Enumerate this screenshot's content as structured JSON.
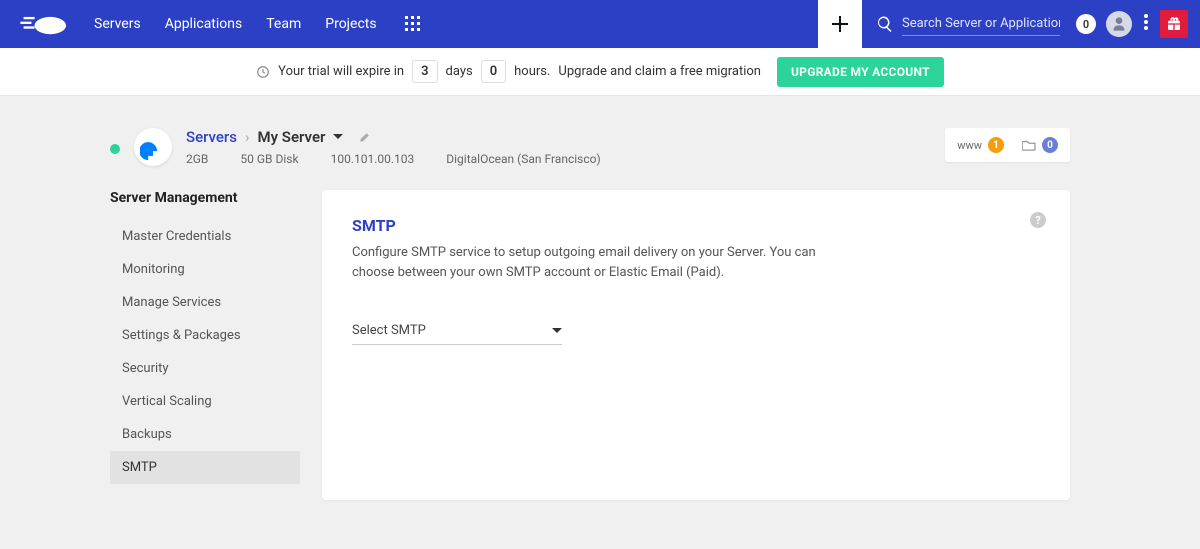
{
  "nav": {
    "servers": "Servers",
    "applications": "Applications",
    "team": "Team",
    "projects": "Projects"
  },
  "search": {
    "placeholder": "Search Server or Application",
    "count": "0"
  },
  "trial": {
    "prefix": "Your trial will expire in",
    "days": "3",
    "days_label": "days",
    "hours": "0",
    "hours_label": "hours.",
    "suffix": "Upgrade and claim a free migration",
    "button": "UPGRADE MY ACCOUNT"
  },
  "breadcrumb": {
    "root": "Servers",
    "current": "My Server"
  },
  "server_meta": {
    "ram": "2GB",
    "disk": "50 GB Disk",
    "ip": "100.101.00.103",
    "provider": "DigitalOcean (San Francisco)"
  },
  "chips": {
    "www_label": "www",
    "www_count": "1",
    "apps_count": "0"
  },
  "sidebar": {
    "heading": "Server Management",
    "items": [
      "Master Credentials",
      "Monitoring",
      "Manage Services",
      "Settings & Packages",
      "Security",
      "Vertical Scaling",
      "Backups",
      "SMTP"
    ],
    "active_index": 7
  },
  "panel": {
    "title": "SMTP",
    "desc": "Configure SMTP service to setup outgoing email delivery on your Server. You can choose between your own SMTP account or Elastic Email (Paid).",
    "select_label": "Select SMTP",
    "help": "?"
  }
}
